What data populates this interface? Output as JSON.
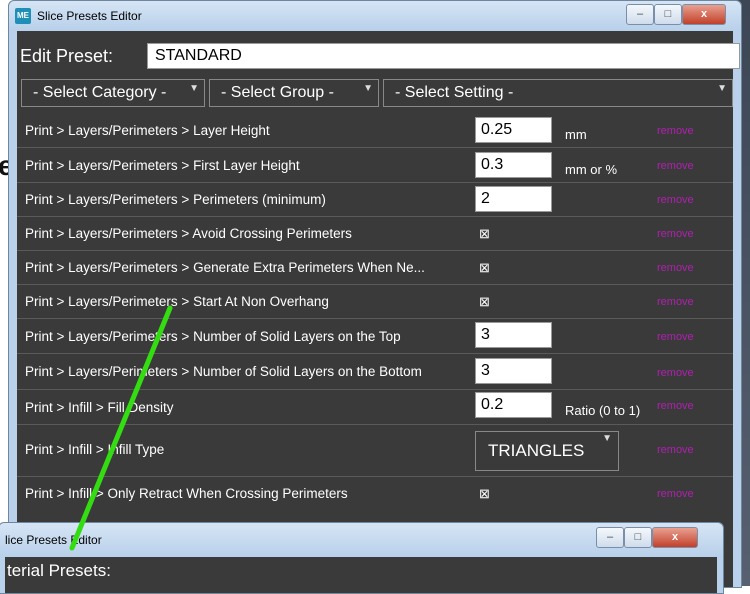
{
  "window": {
    "title": "Slice Presets Editor",
    "app_icon_text": "ME",
    "controls": {
      "minimize": "–",
      "maximize": "□",
      "close": "x"
    }
  },
  "background": {
    "partial_letter": "e"
  },
  "edit_preset": {
    "label": "Edit Preset:",
    "value": "STANDARD"
  },
  "selectors": {
    "category": "- Select Category -",
    "group": "- Select Group -",
    "setting": "- Select Setting -"
  },
  "settings_rows": [
    {
      "label": "Print > Layers/Perimeters > Layer Height",
      "value": "0.25",
      "unit": "mm",
      "remove": "remove"
    },
    {
      "label": "Print > Layers/Perimeters > First Layer Height",
      "value": "0.3",
      "unit": "mm or %",
      "remove": "remove"
    },
    {
      "label": "Print > Layers/Perimeters > Perimeters (minimum)",
      "value": "2",
      "remove": "remove"
    },
    {
      "label": "Print > Layers/Perimeters > Avoid Crossing Perimeters",
      "checkbox": "⊠",
      "remove": "remove"
    },
    {
      "label": "Print > Layers/Perimeters > Generate Extra Perimeters When Ne...",
      "checkbox": "⊠",
      "remove": "remove"
    },
    {
      "label": "Print > Layers/Perimeters > Start At Non Overhang",
      "checkbox": "⊠",
      "remove": "remove"
    },
    {
      "label": "Print > Layers/Perimeters > Number of Solid Layers on the Top",
      "value": "3",
      "remove": "remove"
    },
    {
      "label": "Print > Layers/Perimeters > Number of Solid Layers on the Bottom",
      "value": "3",
      "remove": "remove"
    },
    {
      "label": "Print > Infill > Fill Density",
      "value": "0.2",
      "unit": "Ratio (0 to 1)",
      "remove": "remove"
    },
    {
      "label": "Print > Infill > Infill Type",
      "dropdown": "TRIANGLES",
      "remove": "remove"
    },
    {
      "label": "Print > Infill > Only Retract When Crossing Perimeters",
      "checkbox": "⊠",
      "remove": "remove"
    }
  ],
  "second_window": {
    "title": "lice Presets Editor",
    "partial_heading": "terial Presets:"
  },
  "colors": {
    "client_bg": "#3a3a3a",
    "remove_link": "#b020b0",
    "annotation_arrow": "#33dd11"
  }
}
